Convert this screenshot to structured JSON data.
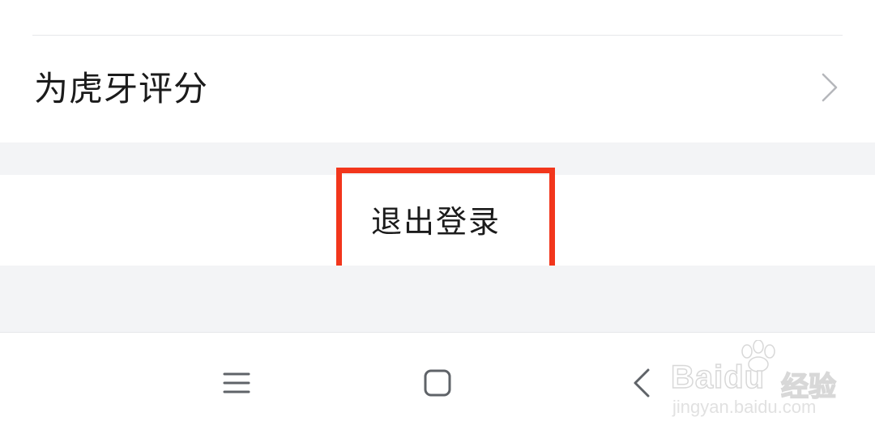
{
  "settings": {
    "rate_item": {
      "label": "为虎牙评分",
      "chevron_icon": "chevron-right-icon"
    },
    "logout_button": {
      "label": "退出登录",
      "highlight_color": "#f2361c"
    }
  },
  "system_nav": {
    "menu_icon": "menu-icon",
    "home_icon": "home-icon",
    "back_icon": "back-icon"
  },
  "watermark": {
    "brand": "Baidu",
    "product": "经验",
    "url": "jingyan.baidu.com"
  },
  "colors": {
    "background": "#ffffff",
    "section_gap": "#f3f4f6",
    "text": "#1b1b1b",
    "icon": "#5f6368",
    "highlight": "#f2361c"
  }
}
